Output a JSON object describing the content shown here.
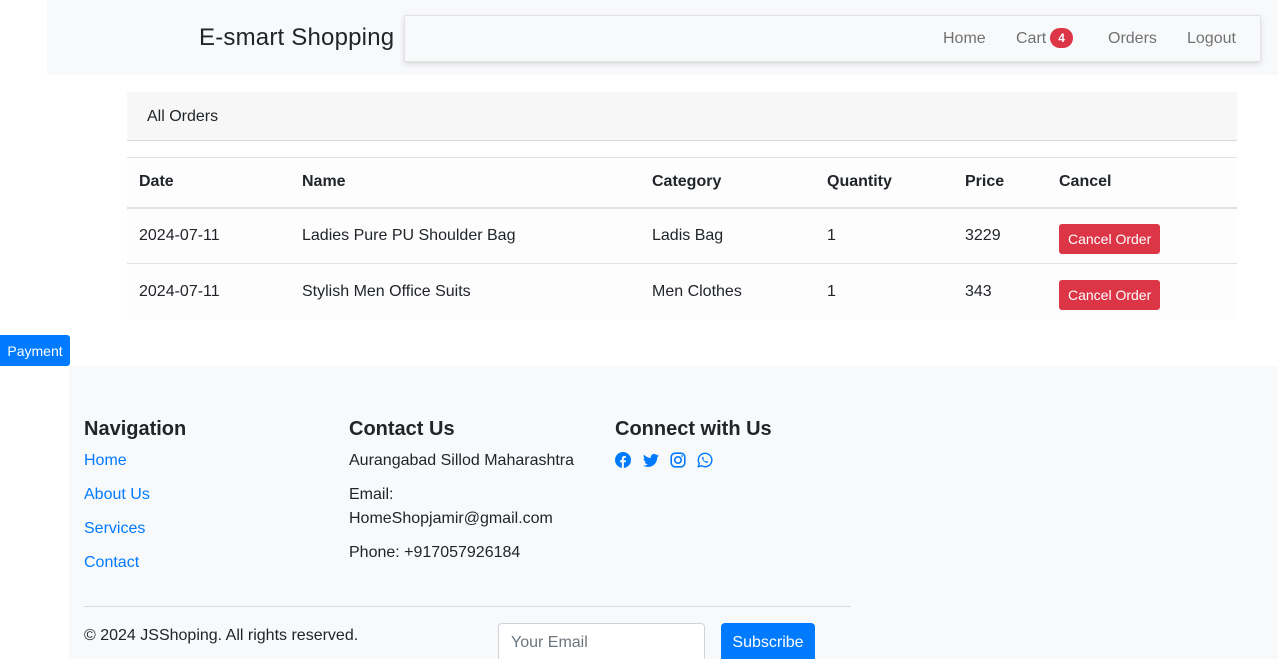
{
  "header": {
    "brand": "E-smart Shopping",
    "nav": {
      "home": "Home",
      "cart": "Cart",
      "cart_count": "4",
      "orders": "Orders",
      "logout": "Logout"
    }
  },
  "orders": {
    "title": "All Orders",
    "columns": [
      "Date",
      "Name",
      "Category",
      "Quantity",
      "Price",
      "Cancel"
    ],
    "rows": [
      {
        "date": "2024-07-11",
        "name": "Ladies Pure PU Shoulder Bag",
        "category": "Ladis Bag",
        "quantity": "1",
        "price": "3229",
        "action": "Cancel Order"
      },
      {
        "date": "2024-07-11",
        "name": "Stylish Men Office Suits",
        "category": "Men Clothes",
        "quantity": "1",
        "price": "343",
        "action": "Cancel Order"
      }
    ]
  },
  "payment_button": "Payment",
  "footer": {
    "navigation": {
      "title": "Navigation",
      "links": [
        "Home",
        "About Us",
        "Services",
        "Contact"
      ]
    },
    "contact": {
      "title": "Contact Us",
      "address": "Aurangabad Sillod Maharashtra",
      "email_label": "Email:",
      "email": "HomeShopjamir@gmail.com",
      "phone": "Phone: +917057926184"
    },
    "connect": {
      "title": "Connect with Us",
      "icons": [
        "facebook-icon",
        "twitter-icon",
        "instagram-icon",
        "whatsapp-icon"
      ]
    },
    "copyright": "© 2024 JSShoping. All rights reserved.",
    "subscribe": {
      "placeholder": "Your Email",
      "button": "Subscribe"
    }
  },
  "colors": {
    "primary": "#007bff",
    "danger": "#dc3545",
    "light_bg": "#f8f9fa"
  }
}
